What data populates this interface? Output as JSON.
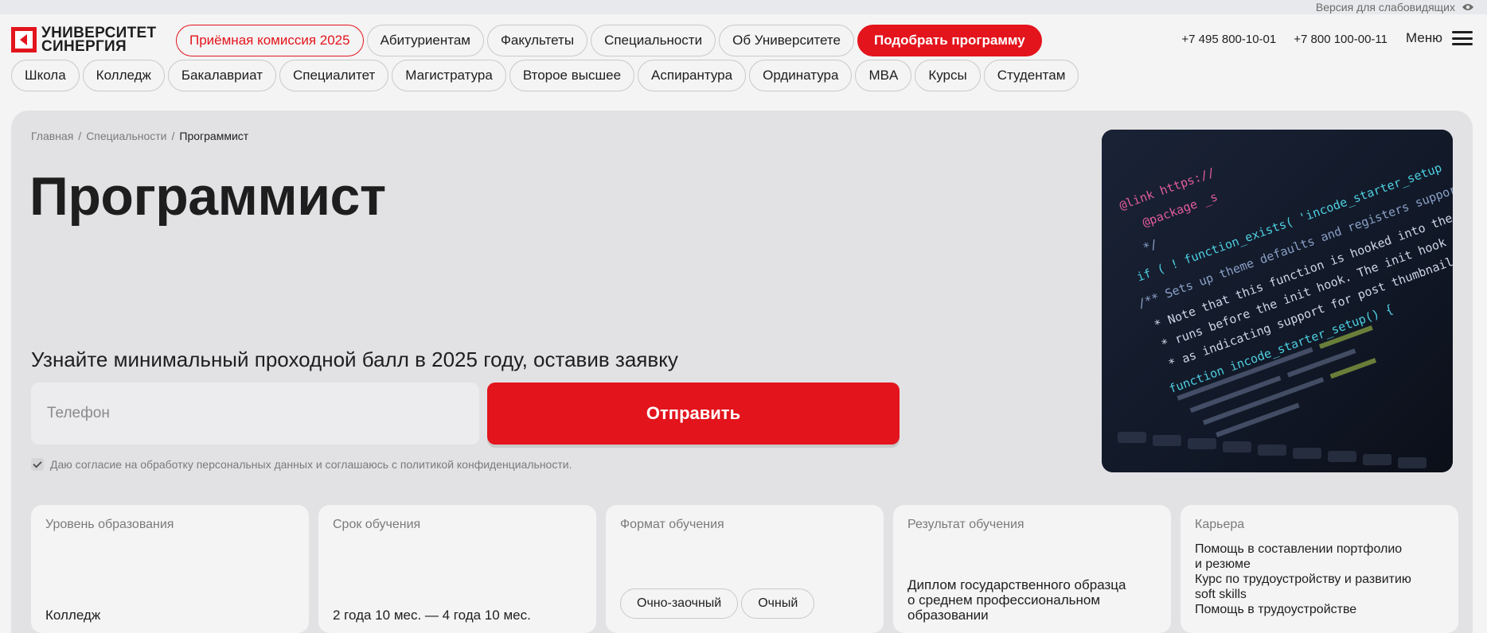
{
  "accessibility": {
    "label": "Версия для слабовидящих",
    "icon": "eye-icon"
  },
  "logo": {
    "line1": "УНИВЕРСИТЕТ",
    "line2": "СИНЕРГИЯ"
  },
  "nav_primary": [
    {
      "label": "Приёмная комиссия 2025",
      "style": "red-outline"
    },
    {
      "label": "Абитуриентам",
      "style": ""
    },
    {
      "label": "Факультеты",
      "style": ""
    },
    {
      "label": "Специальности",
      "style": ""
    },
    {
      "label": "Об Университете",
      "style": ""
    },
    {
      "label": "Подобрать программу",
      "style": "red-fill"
    }
  ],
  "phones": [
    "+7 495 800-10-01",
    "+7 800 100-00-11"
  ],
  "menu_label": "Меню",
  "nav_secondary": [
    "Школа",
    "Колледж",
    "Бакалавриат",
    "Специалитет",
    "Магистратура",
    "Второе высшее",
    "Аспирантура",
    "Ординатура",
    "MBA",
    "Курсы",
    "Студентам"
  ],
  "breadcrumbs": [
    "Главная",
    "Специальности",
    "Программист"
  ],
  "page_title": "Программист",
  "lead_form": {
    "heading": "Узнайте минимальный проходной балл в 2025 году, оставив заявку",
    "phone_placeholder": "Телефон",
    "phone_value": "",
    "submit_label": "Отправить",
    "consent_text": "Даю согласие на обработку персональных данных и соглашаюсь с политикой конфиденциальности.",
    "consent_checked": true
  },
  "hero_image": {
    "code_lines": [
      "@link https://",
      "@package _s",
      "*/",
      "if ( ! function_exists( 'incode_starter_setup",
      "/** Sets up theme defaults and registers support",
      "* Note that this function is hooked into the",
      "* runs before the init hook. The init hook is",
      "* as indicating support for post thumbnails.",
      "function incode_starter_setup() {"
    ]
  },
  "cards": [
    {
      "heading": "Уровень образования",
      "value": "Колледж"
    },
    {
      "heading": "Срок обучения",
      "value": "2 года 10 мес. — 4 года 10 мес."
    },
    {
      "heading": "Формат обучения",
      "tags": [
        "Очно-заочный",
        "Очный"
      ]
    },
    {
      "heading": "Результат обучения",
      "value_lines": [
        "Диплом государственного образца",
        "о среднем профессиональном",
        "образовании"
      ]
    },
    {
      "heading": "Карьера",
      "lines": [
        "Помощь в составлении портфолио",
        "и резюме",
        "Курс по трудоустройству и развитию",
        "soft skills",
        "Помощь в трудоустройстве"
      ]
    }
  ],
  "colors": {
    "brand_red": "#e3141c",
    "hero_bg": "#e2e2e5",
    "page_bg": "#f4f4f4"
  }
}
